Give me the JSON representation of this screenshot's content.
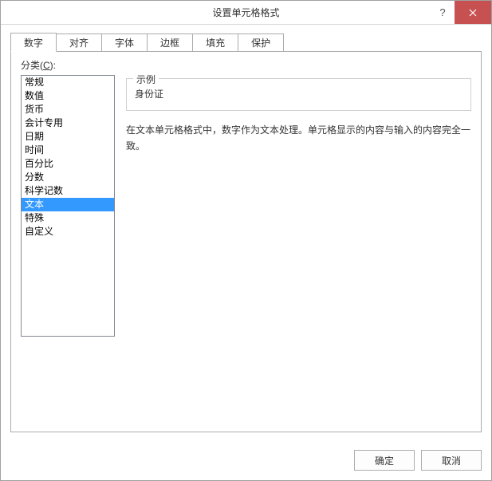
{
  "titlebar": {
    "title": "设置单元格格式",
    "help": "?",
    "close": "×"
  },
  "tabs": [
    {
      "label": "数字",
      "active": true
    },
    {
      "label": "对齐",
      "active": false
    },
    {
      "label": "字体",
      "active": false
    },
    {
      "label": "边框",
      "active": false
    },
    {
      "label": "填充",
      "active": false
    },
    {
      "label": "保护",
      "active": false
    }
  ],
  "category": {
    "label_prefix": "分类(",
    "label_key": "C",
    "label_suffix": "):",
    "items": [
      {
        "label": "常规",
        "selected": false
      },
      {
        "label": "数值",
        "selected": false
      },
      {
        "label": "货币",
        "selected": false
      },
      {
        "label": "会计专用",
        "selected": false
      },
      {
        "label": "日期",
        "selected": false
      },
      {
        "label": "时间",
        "selected": false
      },
      {
        "label": "百分比",
        "selected": false
      },
      {
        "label": "分数",
        "selected": false
      },
      {
        "label": "科学记数",
        "selected": false
      },
      {
        "label": "文本",
        "selected": true
      },
      {
        "label": "特殊",
        "selected": false
      },
      {
        "label": "自定义",
        "selected": false
      }
    ]
  },
  "example": {
    "legend": "示例",
    "value": "身份证"
  },
  "description": "在文本单元格格式中，数字作为文本处理。单元格显示的内容与输入的内容完全一致。",
  "footer": {
    "ok": "确定",
    "cancel": "取消"
  }
}
